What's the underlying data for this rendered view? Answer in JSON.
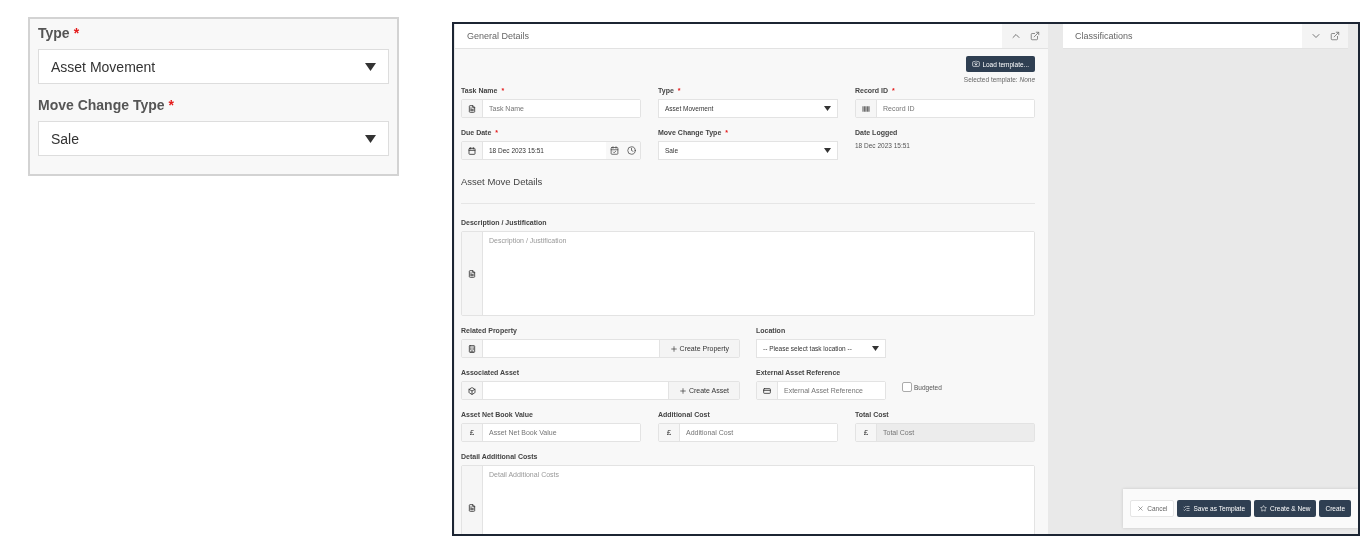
{
  "inset": {
    "fields": [
      {
        "label": "Type",
        "mark": "*",
        "value": "Asset Movement"
      },
      {
        "label": "Move Change Type",
        "mark": "*",
        "value": "Sale"
      }
    ]
  },
  "general": {
    "title": "General Details",
    "expanded": true,
    "load_template": "Load template...",
    "selected_template_label": "Selected template:",
    "selected_template": "None",
    "rows": [
      {
        "kind": "three",
        "fields": [
          {
            "kind": "text",
            "label": "Task Name",
            "mark": "*",
            "placeholder": "Task Name"
          },
          {
            "kind": "select",
            "label": "Type",
            "mark": "*",
            "value": "Asset Movement"
          },
          {
            "kind": "text",
            "label": "Record ID",
            "mark": "*",
            "placeholder": "Record ID"
          }
        ]
      },
      {
        "kind": "three",
        "fields": [
          {
            "kind": "datetime",
            "label": "Due Date",
            "mark": "*",
            "value": "18 Dec 2023 15:51"
          },
          {
            "kind": "select",
            "label": "Move Change Type",
            "mark": "*",
            "value": "Sale"
          },
          {
            "kind": "static",
            "label": "Date Logged",
            "value": "18 Dec 2023 15:51"
          }
        ]
      },
      {
        "kind": "heading",
        "title": "Asset Move Details"
      },
      {
        "kind": "full",
        "fields": [
          {
            "kind": "textarea",
            "label": "Description / Justification",
            "placeholder": "Description / Justification"
          }
        ]
      },
      {
        "kind": "two",
        "fields": [
          {
            "kind": "lookup",
            "label": "Related Property",
            "button": "Create Property"
          },
          {
            "kind": "select",
            "label": "Location",
            "value": "-- Please select task location --"
          }
        ]
      },
      {
        "kind": "two",
        "fields": [
          {
            "kind": "lookup",
            "label": "Associated Asset",
            "button": "Create Asset"
          },
          {
            "kind": "text",
            "label": "External Asset Reference",
            "placeholder": "External Asset Reference"
          },
          {
            "kind": "checkbox",
            "label": "Budgeted",
            "checked": false
          }
        ]
      },
      {
        "kind": "three",
        "fields": [
          {
            "kind": "currency",
            "label": "Asset Net Book Value",
            "prefix": "£",
            "placeholder": "Asset Net Book Value",
            "disabled": false
          },
          {
            "kind": "currency",
            "label": "Additional Cost",
            "prefix": "£",
            "placeholder": "Additional Cost",
            "disabled": false
          },
          {
            "kind": "currency",
            "label": "Total Cost",
            "prefix": "£",
            "placeholder": "Total Cost",
            "disabled": true
          }
        ]
      },
      {
        "kind": "full",
        "fields": [
          {
            "kind": "textarea",
            "label": "Detail Additional Costs",
            "placeholder": "Detail Additional Costs"
          }
        ]
      }
    ]
  },
  "classifications": {
    "title": "Classifications",
    "expanded": false
  },
  "actions": [
    {
      "kind": "cancel",
      "label": "Cancel"
    },
    {
      "kind": "template",
      "label": "Save as Template"
    },
    {
      "kind": "create_new",
      "label": "Create & New"
    },
    {
      "kind": "create",
      "label": "Create"
    }
  ]
}
